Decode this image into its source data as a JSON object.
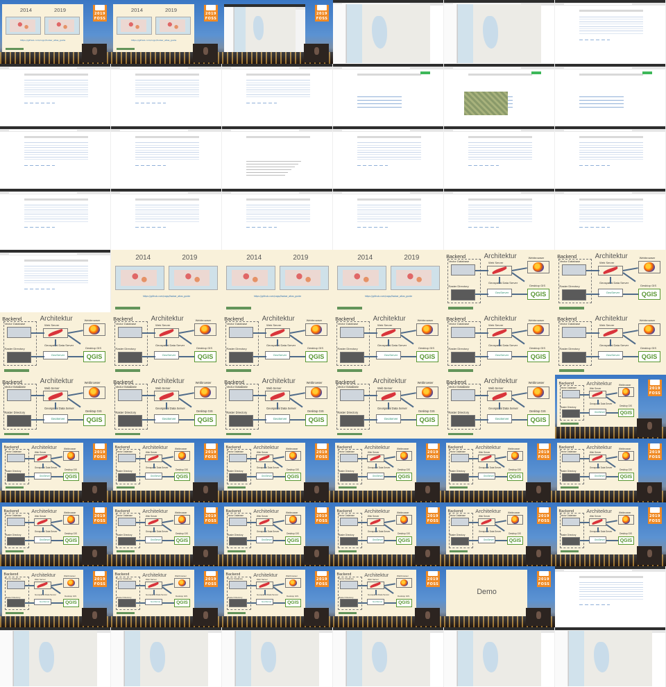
{
  "sheet": {
    "columns": 6,
    "rows": 10
  },
  "slide_text": {
    "year_a": "2014",
    "year_b": "2019",
    "url": "https://github.com/cogo/foobar_atlas_guide",
    "architektur": "Architektur",
    "backend": "Backend",
    "vector_database": "Vector Database",
    "raster_directory": "Raster Directory",
    "web_server": "Web Server",
    "geospatial_data_server": "Geospatial Data Server",
    "webbrowser": "Webbrowser",
    "desktop_gis": "Desktop GIS",
    "qgis": "QGIS",
    "geoserver": "GeoServer",
    "demo": "Demo",
    "foss": "FOSS",
    "foss_year": "2019"
  },
  "tiles": [
    {
      "row": 0,
      "col": 0,
      "kind": "conf",
      "slide": "years"
    },
    {
      "row": 0,
      "col": 1,
      "kind": "conf",
      "slide": "years"
    },
    {
      "row": 0,
      "col": 2,
      "kind": "conf",
      "slide": "browser-map"
    },
    {
      "row": 0,
      "col": 3,
      "kind": "browser",
      "variant": "map"
    },
    {
      "row": 0,
      "col": 4,
      "kind": "browser",
      "variant": "map"
    },
    {
      "row": 0,
      "col": 5,
      "kind": "browser",
      "variant": "list"
    },
    {
      "row": 1,
      "col": 0,
      "kind": "browser",
      "variant": "list"
    },
    {
      "row": 1,
      "col": 1,
      "kind": "browser",
      "variant": "list"
    },
    {
      "row": 1,
      "col": 2,
      "kind": "browser",
      "variant": "list"
    },
    {
      "row": 1,
      "col": 3,
      "kind": "browser",
      "variant": "detail"
    },
    {
      "row": 1,
      "col": 4,
      "kind": "browser",
      "variant": "detail-sat"
    },
    {
      "row": 1,
      "col": 5,
      "kind": "browser",
      "variant": "detail"
    },
    {
      "row": 2,
      "col": 0,
      "kind": "browser",
      "variant": "list"
    },
    {
      "row": 2,
      "col": 1,
      "kind": "browser",
      "variant": "list"
    },
    {
      "row": 2,
      "col": 2,
      "kind": "browser",
      "variant": "text"
    },
    {
      "row": 2,
      "col": 3,
      "kind": "browser",
      "variant": "list"
    },
    {
      "row": 2,
      "col": 4,
      "kind": "browser",
      "variant": "list"
    },
    {
      "row": 2,
      "col": 5,
      "kind": "browser",
      "variant": "list"
    },
    {
      "row": 3,
      "col": 0,
      "kind": "browser",
      "variant": "list"
    },
    {
      "row": 3,
      "col": 1,
      "kind": "browser",
      "variant": "list"
    },
    {
      "row": 3,
      "col": 2,
      "kind": "browser",
      "variant": "list"
    },
    {
      "row": 3,
      "col": 3,
      "kind": "browser",
      "variant": "list"
    },
    {
      "row": 3,
      "col": 4,
      "kind": "browser",
      "variant": "list"
    },
    {
      "row": 3,
      "col": 5,
      "kind": "browser",
      "variant": "list"
    },
    {
      "row": 4,
      "col": 0,
      "kind": "browser",
      "variant": "list"
    },
    {
      "row": 4,
      "col": 1,
      "kind": "full",
      "slide": "years"
    },
    {
      "row": 4,
      "col": 2,
      "kind": "full",
      "slide": "years"
    },
    {
      "row": 4,
      "col": 3,
      "kind": "full",
      "slide": "years"
    },
    {
      "row": 4,
      "col": 4,
      "kind": "full",
      "slide": "arch"
    },
    {
      "row": 4,
      "col": 5,
      "kind": "full",
      "slide": "arch"
    },
    {
      "row": 5,
      "col": 0,
      "kind": "full",
      "slide": "arch"
    },
    {
      "row": 5,
      "col": 1,
      "kind": "full",
      "slide": "arch"
    },
    {
      "row": 5,
      "col": 2,
      "kind": "full",
      "slide": "arch"
    },
    {
      "row": 5,
      "col": 3,
      "kind": "full",
      "slide": "arch"
    },
    {
      "row": 5,
      "col": 4,
      "kind": "full",
      "slide": "arch"
    },
    {
      "row": 5,
      "col": 5,
      "kind": "full",
      "slide": "arch"
    },
    {
      "row": 6,
      "col": 0,
      "kind": "full",
      "slide": "arch"
    },
    {
      "row": 6,
      "col": 1,
      "kind": "full",
      "slide": "arch"
    },
    {
      "row": 6,
      "col": 2,
      "kind": "full",
      "slide": "arch"
    },
    {
      "row": 6,
      "col": 3,
      "kind": "full",
      "slide": "arch"
    },
    {
      "row": 6,
      "col": 4,
      "kind": "full",
      "slide": "arch"
    },
    {
      "row": 6,
      "col": 5,
      "kind": "conf",
      "slide": "arch"
    },
    {
      "row": 7,
      "col": 0,
      "kind": "conf",
      "slide": "arch"
    },
    {
      "row": 7,
      "col": 1,
      "kind": "conf",
      "slide": "arch"
    },
    {
      "row": 7,
      "col": 2,
      "kind": "conf",
      "slide": "arch"
    },
    {
      "row": 7,
      "col": 3,
      "kind": "conf",
      "slide": "arch"
    },
    {
      "row": 7,
      "col": 4,
      "kind": "conf",
      "slide": "arch"
    },
    {
      "row": 7,
      "col": 5,
      "kind": "conf",
      "slide": "arch"
    },
    {
      "row": 8,
      "col": 0,
      "kind": "conf",
      "slide": "arch"
    },
    {
      "row": 8,
      "col": 1,
      "kind": "conf",
      "slide": "arch"
    },
    {
      "row": 8,
      "col": 2,
      "kind": "conf",
      "slide": "arch"
    },
    {
      "row": 8,
      "col": 3,
      "kind": "conf",
      "slide": "arch"
    },
    {
      "row": 8,
      "col": 4,
      "kind": "conf",
      "slide": "arch"
    },
    {
      "row": 8,
      "col": 5,
      "kind": "conf",
      "slide": "arch"
    },
    {
      "row": 9,
      "col": 0,
      "kind": "conf",
      "slide": "arch"
    },
    {
      "row": 9,
      "col": 1,
      "kind": "conf",
      "slide": "arch"
    },
    {
      "row": 9,
      "col": 2,
      "kind": "conf",
      "slide": "arch"
    },
    {
      "row": 9,
      "col": 3,
      "kind": "conf",
      "slide": "arch"
    },
    {
      "row": 9,
      "col": 4,
      "kind": "conf",
      "slide": "demo"
    },
    {
      "row": 9,
      "col": 5,
      "kind": "browser",
      "variant": "list"
    },
    {
      "row": 10,
      "col": 0,
      "kind": "browser",
      "variant": "map"
    },
    {
      "row": 10,
      "col": 1,
      "kind": "browser",
      "variant": "map"
    },
    {
      "row": 10,
      "col": 2,
      "kind": "browser",
      "variant": "map"
    },
    {
      "row": 10,
      "col": 3,
      "kind": "browser",
      "variant": "map"
    },
    {
      "row": 10,
      "col": 4,
      "kind": "browser",
      "variant": "map"
    },
    {
      "row": 10,
      "col": 5,
      "kind": "browser",
      "variant": "map"
    }
  ]
}
